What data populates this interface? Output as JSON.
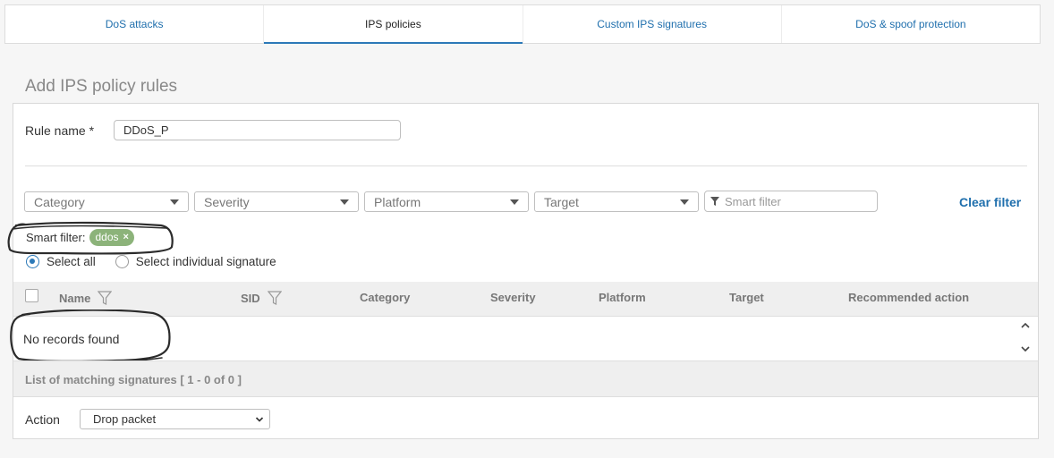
{
  "tabs": [
    {
      "label": "DoS attacks",
      "active": false
    },
    {
      "label": "IPS policies",
      "active": true
    },
    {
      "label": "Custom IPS signatures",
      "active": false
    },
    {
      "label": "DoS & spoof protection",
      "active": false
    }
  ],
  "section_title": "Add IPS policy rules",
  "rule_name": {
    "label": "Rule name *",
    "value": "DDoS_P"
  },
  "filters": {
    "category": "Category",
    "severity": "Severity",
    "platform": "Platform",
    "target": "Target",
    "smart_placeholder": "Smart filter",
    "clear_label": "Clear filter"
  },
  "smart_filter": {
    "label": "Smart filter:",
    "chip": "ddos",
    "chip_close": "×"
  },
  "selection": {
    "select_all": "Select all",
    "select_individual": "Select individual signature"
  },
  "table": {
    "columns": {
      "name": "Name",
      "sid": "SID",
      "category": "Category",
      "severity": "Severity",
      "platform": "Platform",
      "target": "Target",
      "action": "Recommended action"
    },
    "empty_text": "No records found",
    "footer": "List of matching signatures [ 1 - 0 of 0 ]"
  },
  "action": {
    "label": "Action",
    "value": "Drop packet"
  },
  "colors": {
    "accent": "#2c79b8",
    "link": "#1f6fad",
    "chip": "#8cb37a"
  }
}
